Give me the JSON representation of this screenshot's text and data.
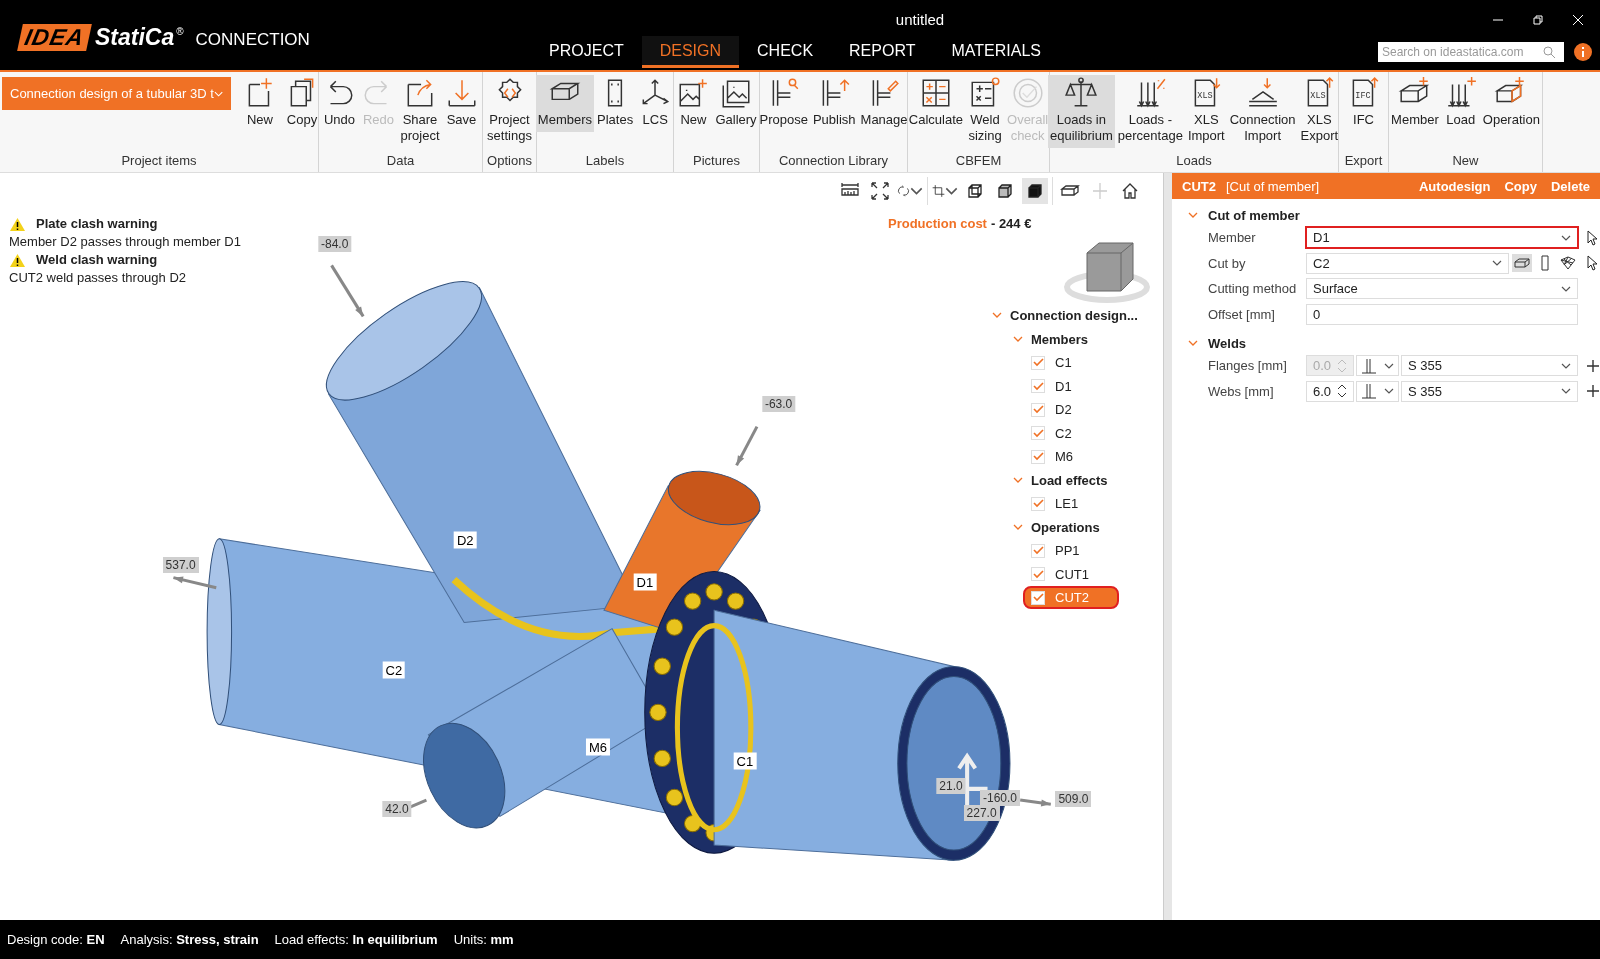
{
  "window": {
    "title": "untitled"
  },
  "logo": {
    "mark": "IDEA",
    "name": "StatiCa",
    "reg": "®",
    "product": "CONNECTION"
  },
  "menu_tabs": [
    {
      "label": "PROJECT",
      "selected": false
    },
    {
      "label": "DESIGN",
      "selected": true
    },
    {
      "label": "CHECK",
      "selected": false
    },
    {
      "label": "REPORT",
      "selected": false
    },
    {
      "label": "MATERIALS",
      "selected": false
    }
  ],
  "search": {
    "placeholder": "Search on ideastatica.com"
  },
  "ribbon": {
    "project_dropdown": "Connection design of a tubular 3D t",
    "groups": [
      {
        "label": "Project items",
        "buttons": [
          {
            "label": "New",
            "selected": false,
            "disabled": false
          },
          {
            "label": "Copy",
            "selected": false,
            "disabled": false
          }
        ]
      },
      {
        "label": "Data",
        "buttons": [
          {
            "label": "Undo",
            "selected": false,
            "disabled": false
          },
          {
            "label": "Redo",
            "selected": false,
            "disabled": true
          },
          {
            "label": "Share\nproject",
            "selected": false,
            "disabled": false
          },
          {
            "label": "Save",
            "selected": false,
            "disabled": false
          }
        ]
      },
      {
        "label": "Options",
        "buttons": [
          {
            "label": "Project\nsettings",
            "selected": false,
            "disabled": false
          }
        ]
      },
      {
        "label": "Labels",
        "buttons": [
          {
            "label": "Members",
            "selected": true,
            "disabled": false
          },
          {
            "label": "Plates",
            "selected": false,
            "disabled": false
          },
          {
            "label": "LCS",
            "selected": false,
            "disabled": false
          }
        ]
      },
      {
        "label": "Pictures",
        "buttons": [
          {
            "label": "New",
            "selected": false,
            "disabled": false
          },
          {
            "label": "Gallery",
            "selected": false,
            "disabled": false
          }
        ]
      },
      {
        "label": "Connection Library",
        "buttons": [
          {
            "label": "Propose",
            "selected": false,
            "disabled": false
          },
          {
            "label": "Publish",
            "selected": false,
            "disabled": false
          },
          {
            "label": "Manage",
            "selected": false,
            "disabled": false
          }
        ]
      },
      {
        "label": "CBFEM",
        "buttons": [
          {
            "label": "Calculate",
            "selected": false,
            "disabled": false
          },
          {
            "label": "Weld\nsizing",
            "selected": false,
            "disabled": false
          },
          {
            "label": "Overall\ncheck",
            "selected": false,
            "disabled": true
          }
        ]
      },
      {
        "label": "Loads",
        "buttons": [
          {
            "label": "Loads in\nequilibrium",
            "selected": true,
            "disabled": false
          },
          {
            "label": "Loads -\npercentage",
            "selected": false,
            "disabled": false
          },
          {
            "label": "XLS\nImport",
            "selected": false,
            "disabled": false,
            "file_type": "XLS"
          },
          {
            "label": "Connection\nImport",
            "selected": false,
            "disabled": false
          },
          {
            "label": "XLS\nExport",
            "selected": false,
            "disabled": false,
            "file_type": "XLS"
          }
        ]
      },
      {
        "label": "Export",
        "buttons": [
          {
            "label": "IFC",
            "selected": false,
            "disabled": false,
            "file_type": "IFC"
          }
        ]
      },
      {
        "label": "New",
        "buttons": [
          {
            "label": "Member",
            "selected": false,
            "disabled": false
          },
          {
            "label": "Load",
            "selected": false,
            "disabled": false
          },
          {
            "label": "Operation",
            "selected": false,
            "disabled": false
          }
        ]
      }
    ]
  },
  "view_modes": [
    {
      "selected": false
    },
    {
      "selected": false
    },
    {
      "selected": true
    }
  ],
  "warnings": [
    {
      "title": "Plate clash warning",
      "message": "Member D2 passes through member D1"
    },
    {
      "title": "Weld clash warning",
      "message": "CUT2 weld passes through D2"
    }
  ],
  "production_cost": {
    "label": "Production cost",
    "value": "- 244 €"
  },
  "model": {
    "member_labels": [
      "D2",
      "D1",
      "C2",
      "M6",
      "C1"
    ],
    "load_labels": [
      "-84.0",
      "-63.0",
      "537.0",
      "42.0",
      "509.0",
      "21.0",
      "-160.0",
      "227.0"
    ]
  },
  "tree": {
    "label": "Connection design...",
    "kind": "group",
    "expanded": true,
    "children": [
      {
        "label": "Members",
        "kind": "group",
        "expanded": true,
        "children": [
          {
            "label": "C1",
            "kind": "item",
            "checked": true,
            "selected": false
          },
          {
            "label": "D1",
            "kind": "item",
            "checked": true,
            "selected": false
          },
          {
            "label": "D2",
            "kind": "item",
            "checked": true,
            "selected": false
          },
          {
            "label": "C2",
            "kind": "item",
            "checked": true,
            "selected": false
          },
          {
            "label": "M6",
            "kind": "item",
            "checked": true,
            "selected": false
          }
        ]
      },
      {
        "label": "Load effects",
        "kind": "group",
        "expanded": true,
        "children": [
          {
            "label": "LE1",
            "kind": "item",
            "checked": true,
            "selected": false
          }
        ]
      },
      {
        "label": "Operations",
        "kind": "group",
        "expanded": true,
        "children": [
          {
            "label": "PP1",
            "kind": "item",
            "checked": true,
            "selected": false
          },
          {
            "label": "CUT1",
            "kind": "item",
            "checked": true,
            "selected": false
          },
          {
            "label": "CUT2",
            "kind": "item",
            "checked": true,
            "selected": true
          }
        ]
      }
    ]
  },
  "panel": {
    "name": "CUT2",
    "type": "[Cut of member]",
    "actions": [
      "Autodesign",
      "Copy",
      "Delete"
    ],
    "sections": [
      {
        "title": "Cut of member",
        "expanded": true,
        "rows": [
          {
            "kind": "dropdown",
            "label": "Member",
            "value": "D1",
            "highlighted": true,
            "picker": true
          },
          {
            "kind": "cutby",
            "label": "Cut by",
            "value": "C2",
            "highlighted": false,
            "picker": true
          },
          {
            "kind": "dropdown",
            "label": "Cutting method",
            "value": "Surface",
            "highlighted": false,
            "picker": false
          },
          {
            "kind": "text",
            "label": "Offset [mm]",
            "value": "0",
            "highlighted": false,
            "picker": false
          }
        ]
      },
      {
        "title": "Welds",
        "expanded": true,
        "rows": [
          {
            "kind": "weld",
            "label": "Flanges [mm]",
            "value": "0.0",
            "disabled": true,
            "material": "S 355"
          },
          {
            "kind": "weld",
            "label": "Webs [mm]",
            "value": "6.0",
            "disabled": false,
            "material": "S 355"
          }
        ]
      }
    ]
  },
  "status_bar": [
    "Design code: **EN**",
    "Analysis: **Stress, strain**",
    "Load effects: **In equilibrium**",
    "Units: **mm**"
  ]
}
